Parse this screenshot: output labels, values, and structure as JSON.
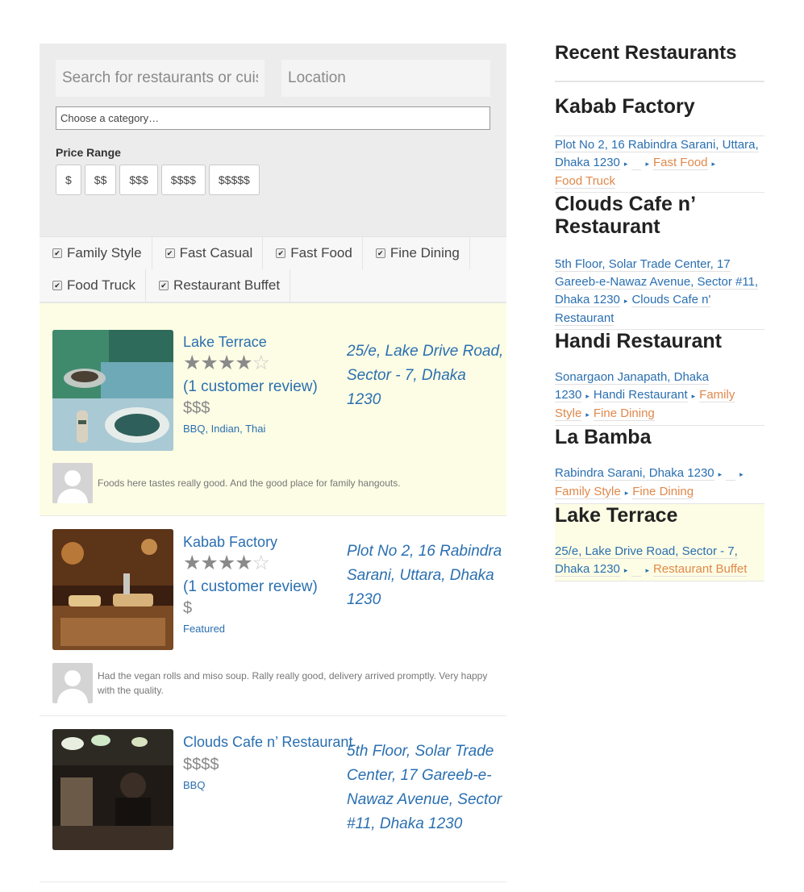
{
  "search": {
    "query_placeholder": "Search for restaurants or cuisines",
    "location_placeholder": "Location",
    "category_placeholder": "Choose a category…"
  },
  "price_range": {
    "label": "Price Range",
    "options": [
      "$",
      "$$",
      "$$$",
      "$$$$",
      "$$$$$"
    ]
  },
  "types": [
    "Family Style",
    "Fast Casual",
    "Fast Food",
    "Fine Dining",
    "Food Truck",
    "Restaurant Buffet"
  ],
  "listings": [
    {
      "name": "Lake Terrace",
      "rating": 4,
      "reviews": "(1 customer review)",
      "price": "$$$",
      "categories": "BBQ, Indian, Thai",
      "address": "25/e, Lake Drive Road, Sector - 7, Dhaka 1230",
      "review_text": "Foods here tastes really good. And the good place for family hangouts."
    },
    {
      "name": "Kabab Factory",
      "rating": 4,
      "reviews": "(1 customer review)",
      "price": "$",
      "categories": "Featured",
      "address": "Plot No 2, 16 Rabindra Sarani, Uttara, Dhaka 1230",
      "review_text": "Had the vegan rolls and miso soup. Rally really good, delivery arrived promptly. Very happy with the quality."
    },
    {
      "name": "Clouds Cafe n’ Restaurant",
      "price": "$$$$",
      "categories": "BBQ",
      "address": "5th Floor, Solar Trade Center, 17 Gareeb-e-Nawaz Avenue, Sector #11, Dhaka 1230"
    }
  ],
  "sidebar": {
    "title": "Recent Restaurants",
    "items": [
      {
        "name": "Kabab Factory",
        "address": "Plot No 2, 16 Rabindra Sarani, Uttara, Dhaka 1230",
        "tags": [
          "Fast Food",
          "Food Truck"
        ]
      },
      {
        "name": "Clouds Cafe n’ Restaurant",
        "address": "5th Floor, Solar Trade Center, 17 Gareeb-e-Nawaz Avenue, Sector #11, Dhaka 1230",
        "extra_link": "Clouds Cafe n' Restaurant"
      },
      {
        "name": "Handi Restaurant",
        "address": "Sonargaon Janapath, Dhaka 1230",
        "extra_link": "Handi Restaurant",
        "tags": [
          "Family Style",
          "Fine Dining"
        ]
      },
      {
        "name": "La Bamba",
        "address": "Rabindra Sarani, Dhaka 1230",
        "tags": [
          "Family Style",
          "Fine Dining"
        ]
      },
      {
        "name": "Lake Terrace",
        "address": "25/e, Lake Drive Road, Sector - 7, Dhaka 1230",
        "tags": [
          "Restaurant Buffet"
        ]
      }
    ]
  },
  "icons": {
    "check": "check-icon",
    "separator": "triangle-right-icon",
    "star": "star-icon"
  },
  "colors": {
    "link": "#2a6fb0",
    "tag": "#e0884a",
    "highlight": "#fdfde5"
  }
}
